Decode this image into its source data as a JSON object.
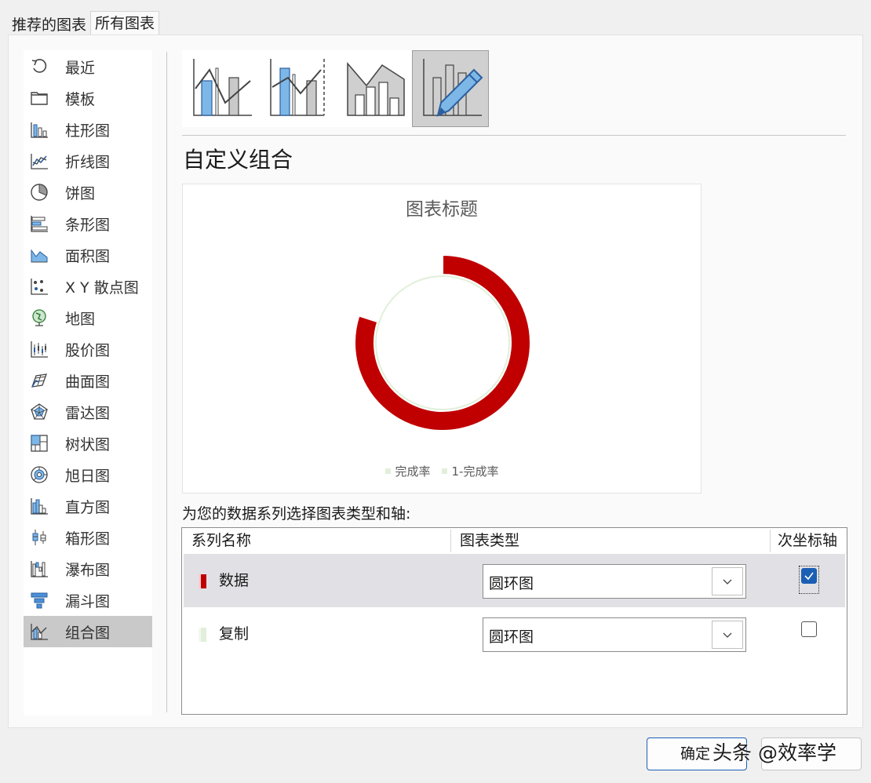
{
  "tabs": {
    "recommended": "推荐的图表",
    "all_charts": "所有图表"
  },
  "sidebar": {
    "items": [
      {
        "label": "最近",
        "icon": "recent-icon"
      },
      {
        "label": "模板",
        "icon": "folder-icon"
      },
      {
        "label": "柱形图",
        "icon": "column-chart-icon"
      },
      {
        "label": "折线图",
        "icon": "line-chart-icon"
      },
      {
        "label": "饼图",
        "icon": "pie-chart-icon"
      },
      {
        "label": "条形图",
        "icon": "bar-chart-icon"
      },
      {
        "label": "面积图",
        "icon": "area-chart-icon"
      },
      {
        "label": "X Y 散点图",
        "icon": "scatter-chart-icon"
      },
      {
        "label": "地图",
        "icon": "globe-icon"
      },
      {
        "label": "股价图",
        "icon": "stock-chart-icon"
      },
      {
        "label": "曲面图",
        "icon": "surface-chart-icon"
      },
      {
        "label": "雷达图",
        "icon": "radar-chart-icon"
      },
      {
        "label": "树状图",
        "icon": "treemap-icon"
      },
      {
        "label": "旭日图",
        "icon": "sunburst-icon"
      },
      {
        "label": "直方图",
        "icon": "histogram-icon"
      },
      {
        "label": "箱形图",
        "icon": "box-whisker-icon"
      },
      {
        "label": "瀑布图",
        "icon": "waterfall-icon"
      },
      {
        "label": "漏斗图",
        "icon": "funnel-icon"
      },
      {
        "label": "组合图",
        "icon": "combo-chart-icon"
      }
    ],
    "selected_index": 18
  },
  "subtypes": {
    "items": [
      {
        "icon": "clustered-column-line-icon"
      },
      {
        "icon": "clustered-column-line-secondary-axis-icon"
      },
      {
        "icon": "stacked-area-clustered-column-icon"
      },
      {
        "icon": "custom-combination-pencil-icon"
      }
    ],
    "selected_index": 3
  },
  "section_title": "自定义组合",
  "preview": {
    "title": "图表标题",
    "legend": [
      {
        "label": "完成率",
        "color": "#e2efda"
      },
      {
        "label": "1-完成率",
        "color": "#e2efda"
      }
    ]
  },
  "chart_data": {
    "type": "pie",
    "subtype": "doughnut",
    "title": "图表标题",
    "series": [
      {
        "name": "数据",
        "values": [
          0.8,
          0.2
        ],
        "colors": [
          "#c00000",
          "#ffffff"
        ],
        "axis": "secondary"
      },
      {
        "name": "复制",
        "values": [
          1
        ],
        "colors": [
          "#e2efda"
        ],
        "axis": "primary"
      }
    ],
    "categories": [
      "完成率",
      "1-完成率"
    ],
    "legend_position": "bottom"
  },
  "instruction": "为您的数据系列选择图表类型和轴:",
  "table": {
    "headers": {
      "series_name": "系列名称",
      "chart_type": "图表类型",
      "secondary_axis": "次坐标轴"
    },
    "rows": [
      {
        "name": "数据",
        "color": "#c00000",
        "chart_type": "圆环图",
        "secondary_axis": true
      },
      {
        "name": "复制",
        "color": "#e2efda",
        "chart_type": "圆环图",
        "secondary_axis": false
      }
    ],
    "selected_row": 0
  },
  "buttons": {
    "ok": "确定"
  },
  "watermark": "头条 @效率学"
}
